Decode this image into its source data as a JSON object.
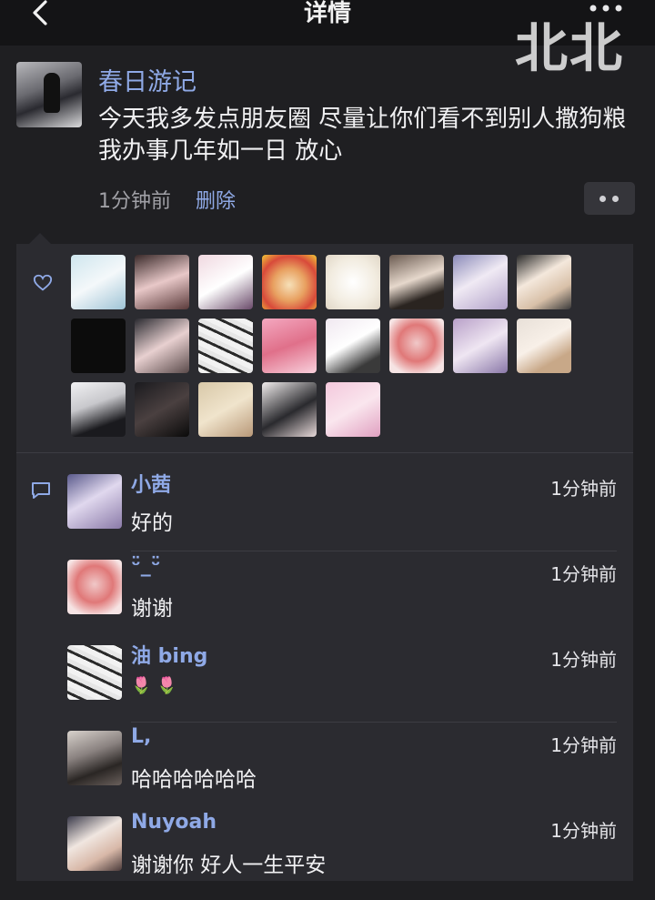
{
  "header": {
    "title": "详情",
    "watermark": "北北",
    "back_icon": "chevron-left-icon",
    "more_icon": "more-dots-icon"
  },
  "post": {
    "author": "春日游记",
    "text": "今天我多发点朋友圈 尽量让你们看不到别人撒狗粮 我办事几年如一日 放心",
    "time": "1分钟前",
    "delete_label": "删除",
    "more_icon": "more-dots-icon"
  },
  "likes": {
    "icon": "heart-icon",
    "count": 21
  },
  "comments": [
    {
      "name": "小茜",
      "time": "1分钟前",
      "text": "好的"
    },
    {
      "name": "ᵕ̈_ᵕ̈",
      "time": "1分钟前",
      "text": "谢谢"
    },
    {
      "name": "油 bing",
      "time": "1分钟前",
      "text": "🌷 🌷"
    },
    {
      "name": "L,",
      "time": "1分钟前",
      "text": "哈哈哈哈哈哈"
    },
    {
      "name": "Nuyoah",
      "time": "1分钟前",
      "text": "谢谢你 好人一生平安"
    }
  ],
  "colors": {
    "background": "#1f1f22",
    "panel": "#2b2b30",
    "link": "#8fa9e6",
    "text": "#f0f0f2",
    "muted": "#a0a0a6"
  }
}
